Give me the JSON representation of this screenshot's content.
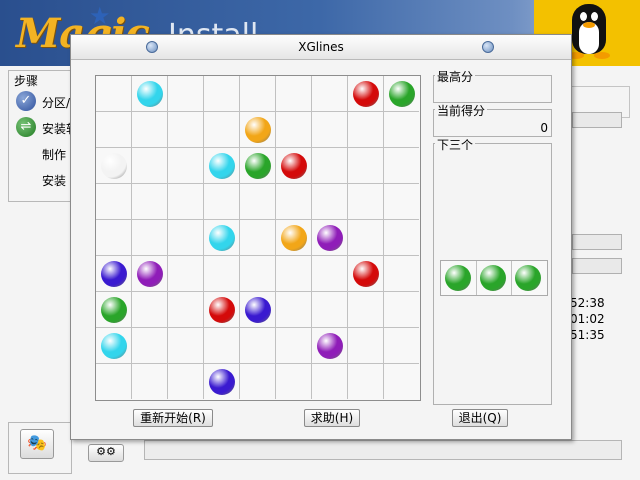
{
  "background_app": {
    "logo_text": "Magic",
    "header_text": "Install",
    "steps_title": "步骤",
    "steps": [
      "分区/",
      "安装软",
      "制作",
      "安装"
    ],
    "times": [
      "52:38",
      "01:02",
      "51:35"
    ]
  },
  "xglines": {
    "title": "XGlines",
    "best_score_label": "最高分",
    "best_score_value": "",
    "current_score_label": "当前得分",
    "current_score_value": "0",
    "next_label": "下三个",
    "buttons": {
      "restart": "重新开始(R)",
      "help": "求助(H)",
      "exit": "退出(Q)"
    },
    "colors": {
      "cyan": "#33d5ec",
      "orange": "#f2a618",
      "red": "#d40a0a",
      "green": "#2aa52a",
      "purple": "#8f1db8",
      "indigo": "#3a1ad0",
      "white": "#f3f3f3"
    },
    "board_rows": 9,
    "board_cols": 9,
    "balls": [
      {
        "row": 0,
        "col": 1,
        "color": "cyan"
      },
      {
        "row": 0,
        "col": 7,
        "color": "red"
      },
      {
        "row": 0,
        "col": 8,
        "color": "green"
      },
      {
        "row": 1,
        "col": 4,
        "color": "orange"
      },
      {
        "row": 2,
        "col": 0,
        "color": "white"
      },
      {
        "row": 2,
        "col": 3,
        "color": "cyan"
      },
      {
        "row": 2,
        "col": 4,
        "color": "green"
      },
      {
        "row": 2,
        "col": 5,
        "color": "red"
      },
      {
        "row": 4,
        "col": 3,
        "color": "cyan"
      },
      {
        "row": 4,
        "col": 5,
        "color": "orange"
      },
      {
        "row": 4,
        "col": 6,
        "color": "purple"
      },
      {
        "row": 5,
        "col": 0,
        "color": "indigo"
      },
      {
        "row": 5,
        "col": 1,
        "color": "purple"
      },
      {
        "row": 5,
        "col": 7,
        "color": "red"
      },
      {
        "row": 6,
        "col": 0,
        "color": "green"
      },
      {
        "row": 6,
        "col": 3,
        "color": "red"
      },
      {
        "row": 6,
        "col": 4,
        "color": "indigo"
      },
      {
        "row": 7,
        "col": 0,
        "color": "cyan"
      },
      {
        "row": 7,
        "col": 6,
        "color": "purple"
      },
      {
        "row": 8,
        "col": 3,
        "color": "indigo"
      }
    ],
    "next_balls": [
      "green",
      "green",
      "green"
    ]
  }
}
